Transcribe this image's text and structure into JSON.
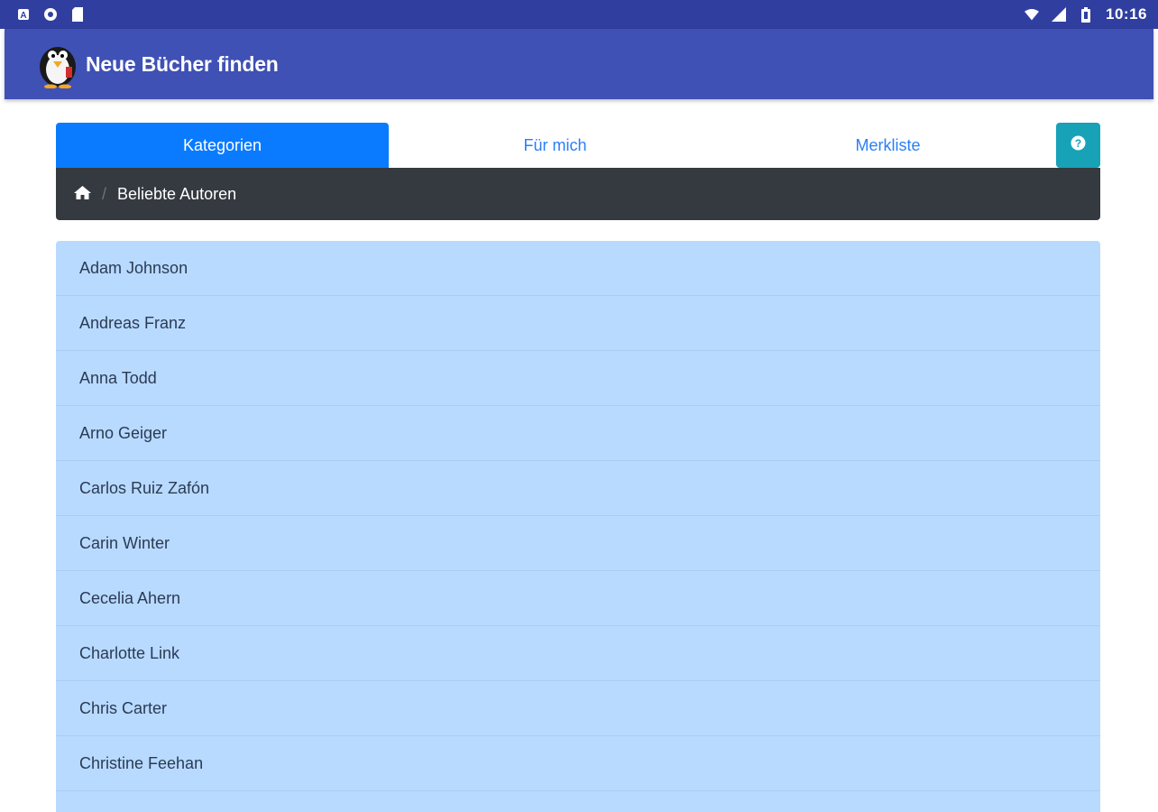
{
  "statusbar": {
    "time": "10:16",
    "left_icons": [
      "notification-a-icon",
      "notification-circle-icon",
      "sd-card-icon"
    ],
    "right_icons": [
      "wifi-icon",
      "cell-signal-icon",
      "battery-icon"
    ]
  },
  "appbar": {
    "title": "Neue Bücher finden",
    "logo": "penguin-logo-icon",
    "color": "#3f51b5"
  },
  "tabs": [
    {
      "label": "Kategorien",
      "active": true
    },
    {
      "label": "Für mich",
      "active": false
    },
    {
      "label": "Merkliste",
      "active": false
    }
  ],
  "help_button": {
    "icon": "question-circle-icon",
    "color": "#17a2b8"
  },
  "breadcrumb": {
    "home_icon": "home-icon",
    "current": "Beliebte Autoren"
  },
  "authors": [
    "Adam Johnson",
    "Andreas Franz",
    "Anna Todd",
    "Arno Geiger",
    "Carlos Ruiz Zafón",
    "Carin Winter",
    "Cecelia Ahern",
    "Charlotte Link",
    "Chris Carter",
    "Christine Feehan"
  ],
  "colors": {
    "primary_dark": "#303f9f",
    "active_tab": "#0a7bff",
    "list_bg": "#b8daff",
    "breadcrumb_bg": "#343a40"
  }
}
